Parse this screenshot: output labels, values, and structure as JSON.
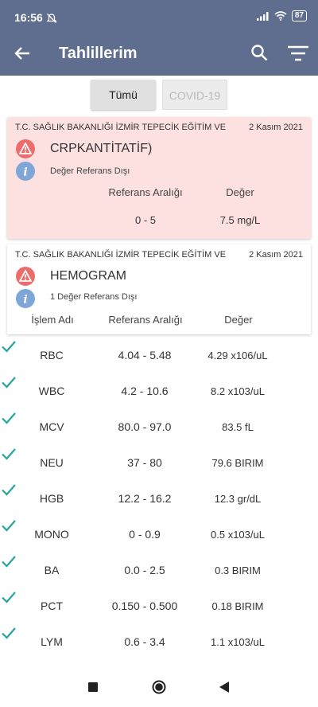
{
  "status_bar": {
    "time": "16:56",
    "battery": "87"
  },
  "app_bar": {
    "title": "Tahlillerim"
  },
  "tabs": [
    {
      "label": "Tümü",
      "active": true
    },
    {
      "label": "COVID-19",
      "active": false
    }
  ],
  "cards": [
    {
      "hospital": "T.C. SAĞLIK BAKANLIĞI İZMİR TEPECİK EĞİTİM VE",
      "date": "2 Kasım 2021",
      "test_name": "CRPKANTİTATİF)",
      "status": "Değer Referans Dışı",
      "headers": {
        "range": "Referans Aralığı",
        "value": "Değer"
      },
      "range": "0 - 5",
      "value": "7.5 mg/L"
    },
    {
      "hospital": "T.C. SAĞLIK BAKANLIĞI İZMİR TEPECİK EĞİTİM VE",
      "date": "2 Kasım 2021",
      "test_name": "HEMOGRAM",
      "status": "1 Değer Referans Dışı",
      "headers": {
        "name": "İşlem Adı",
        "range": "Referans Aralığı",
        "value": "Değer"
      }
    }
  ],
  "results": [
    {
      "name": "RBC",
      "range": "4.04 - 5.48",
      "value": "4.29 x106/uL"
    },
    {
      "name": "WBC",
      "range": "4.2 - 10.6",
      "value": "8.2 x103/uL"
    },
    {
      "name": "MCV",
      "range": "80.0 - 97.0",
      "value": "83.5 fL"
    },
    {
      "name": "NEU",
      "range": "37 - 80",
      "value": "79.6 BIRIM"
    },
    {
      "name": "HGB",
      "range": "12.2 - 16.2",
      "value": "12.3 gr/dL"
    },
    {
      "name": "MONO",
      "range": "0 - 0.9",
      "value": "0.5 x103/uL"
    },
    {
      "name": "BA",
      "range": "0.0 - 2.5",
      "value": "0.3 BIRIM"
    },
    {
      "name": "PCT",
      "range": "0.150 - 0.500",
      "value": "0.18 BIRIM"
    },
    {
      "name": "LYM",
      "range": "0.6 - 3.4",
      "value": "1.1 x103/uL"
    }
  ],
  "colors": {
    "header": "#5f6d8f",
    "alert_card": "#fde1e1",
    "warning": "#ef6c6c",
    "info": "#7ea7d8",
    "check": "#26a69a"
  },
  "icons": {
    "back": "arrow-left-icon",
    "search": "search-icon",
    "filter": "filter-icon",
    "warning": "warning-icon",
    "info": "info-icon",
    "check": "check-icon"
  }
}
